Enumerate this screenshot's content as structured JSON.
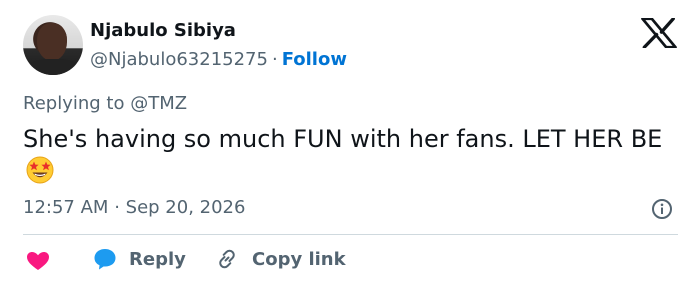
{
  "author": {
    "name": "Njabulo Sibiya",
    "handle": "@Njabulo63215275",
    "separator": "·",
    "follow_label": "Follow"
  },
  "reply_context": {
    "prefix": "Replying to",
    "mention": "@TMZ"
  },
  "tweet": {
    "text": "She's having so much FUN with her fans. LET HER BE",
    "emoji": "star-struck-emoji"
  },
  "meta": {
    "time": "12:57 AM",
    "separator": "·",
    "date": "Sep 20, 2026"
  },
  "actions": {
    "reply_label": "Reply",
    "copy_link_label": "Copy link"
  },
  "colors": {
    "text": "#0f1419",
    "secondary": "#536471",
    "link": "#0074d4",
    "heart": "#f91880",
    "reply_bubble": "#1d9bf0",
    "divider": "#cfd9de"
  },
  "icons": [
    "x-logo-icon",
    "info-icon",
    "heart-icon",
    "reply-bubble-icon",
    "copy-link-icon",
    "star-struck-emoji"
  ]
}
